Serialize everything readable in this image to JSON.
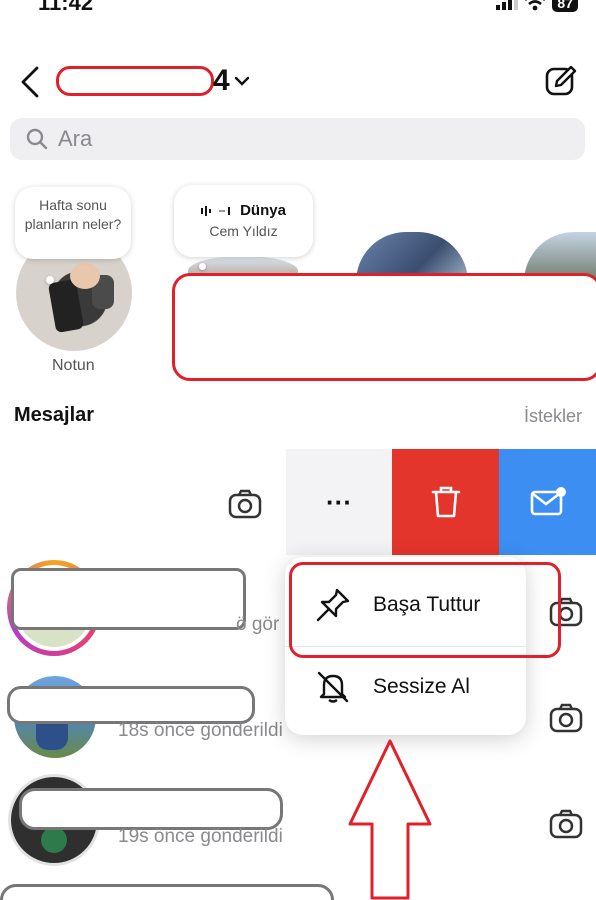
{
  "status": {
    "time": "11:42",
    "battery": "87"
  },
  "header": {
    "handle_suffix": "4"
  },
  "search": {
    "placeholder": "Ara"
  },
  "notes": [
    {
      "bubble": "Hafta sonu planların neler?",
      "label": "Notun"
    },
    {
      "bubble_title": "Dünya",
      "bubble_sub": "Cem Yıldız"
    }
  ],
  "messages": {
    "title": "Mesajlar",
    "requests": "İstekler",
    "rows": [
      {
        "sub": "ö gör"
      },
      {
        "sub": "18s önce gönderildi"
      },
      {
        "sub": "19s önce gönderildi"
      }
    ]
  },
  "swipe_actions": {
    "more": "···"
  },
  "context_menu": {
    "pin": "Başa Tuttur",
    "mute": "Sessize Al"
  },
  "colors": {
    "accent_red": "#e3352b",
    "accent_blue": "#3c8ef2",
    "annotation_red": "#e0202a"
  }
}
